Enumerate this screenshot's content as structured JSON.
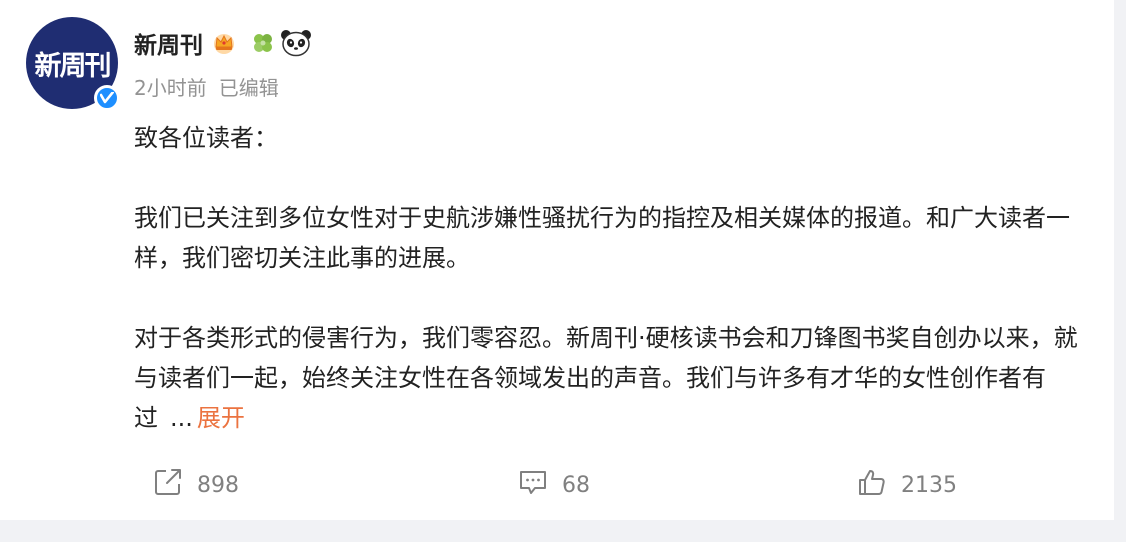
{
  "user": {
    "avatar_text": "新周刊",
    "name": "新周刊",
    "badges": [
      "crown-icon",
      "clover-icon",
      "panda-icon"
    ]
  },
  "meta": {
    "time": "2小时前",
    "edited": "已编辑"
  },
  "post": {
    "greeting": "致各位读者：",
    "paragraph1": "我们已关注到多位女性对于史航涉嫌性骚扰行为的指控及相关媒体的报道。和广大读者一样，我们密切关注此事的进展。",
    "paragraph2": "对于各类形式的侵害行为，我们零容忍。新周刊·硬核读书会和刀锋图书奖自创办以来，就与读者们一起，始终关注女性在各领域发出的声音。我们与许多有才华的女性创作者有过",
    "ellipsis": "...",
    "expand_label": "展开"
  },
  "actions": {
    "forward_count": "898",
    "comment_count": "68",
    "like_count": "2135"
  },
  "colors": {
    "avatar_bg": "#1f2d72",
    "verified": "#1e8fff",
    "expand_link": "#eb7340",
    "muted": "#939393"
  }
}
